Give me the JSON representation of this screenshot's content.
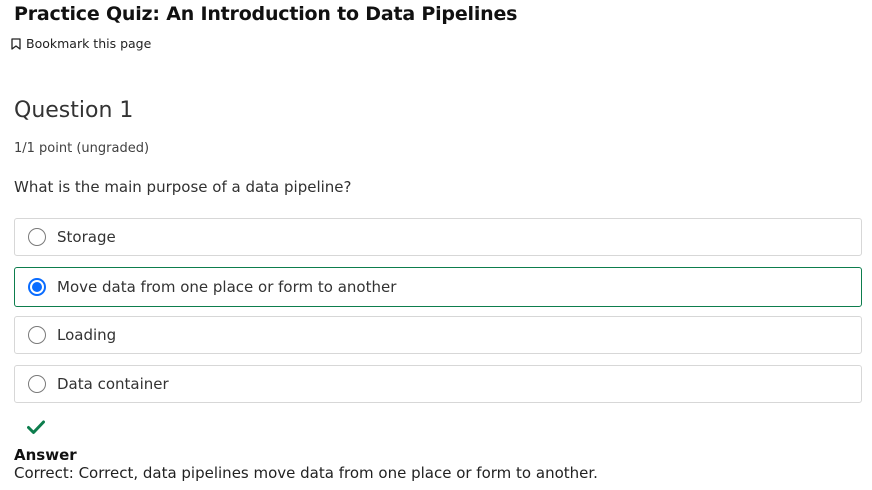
{
  "page": {
    "title": "Practice Quiz: An Introduction to Data Pipelines",
    "bookmark_label": "Bookmark this page"
  },
  "question": {
    "title": "Question 1",
    "points": "1/1 point (ungraded)",
    "prompt": "What is the main purpose of a data pipeline?",
    "options": [
      {
        "label": "Storage",
        "selected": false
      },
      {
        "label": "Move data from one place or form to another",
        "selected": true
      },
      {
        "label": "Loading",
        "selected": false
      },
      {
        "label": "Data container",
        "selected": false
      }
    ]
  },
  "answer": {
    "status_icon": "checkmark-icon",
    "heading": "Answer",
    "text": "Correct:  Correct, data pipelines move data from one place or form to another."
  },
  "colors": {
    "selected_border": "#0d7d4d",
    "radio_checked": "#0a6cff",
    "correct_check": "#0d7d4d"
  }
}
